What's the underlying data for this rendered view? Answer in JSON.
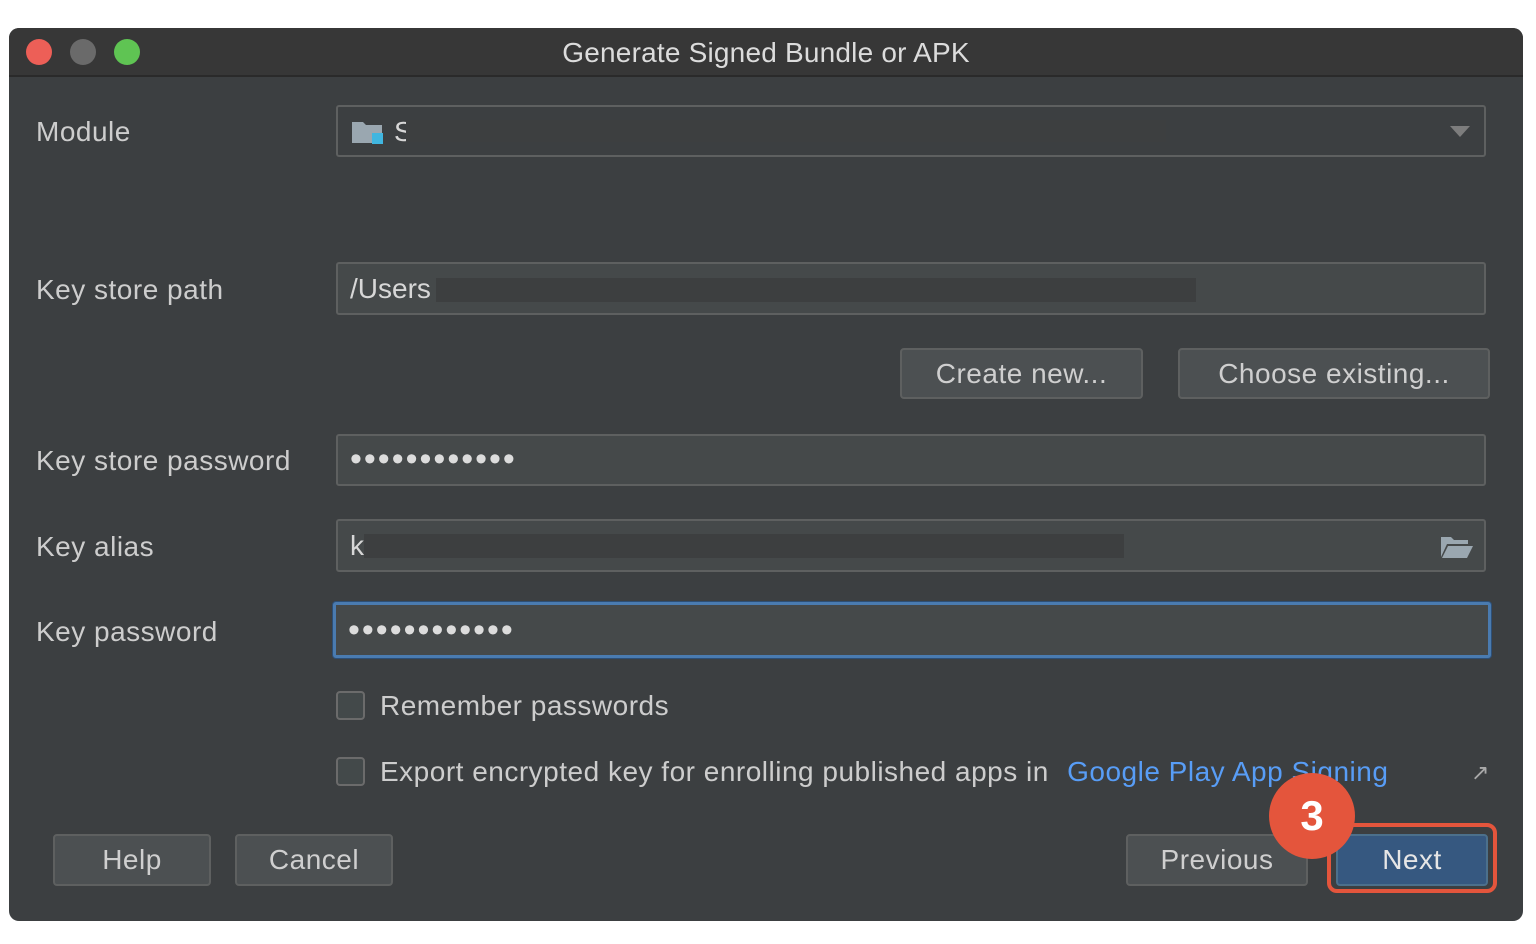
{
  "window": {
    "title": "Generate Signed Bundle or APK"
  },
  "module": {
    "label": "Module",
    "value": "S"
  },
  "key_store_path": {
    "label": "Key store path",
    "value": "/Users"
  },
  "buttons": {
    "create_new": "Create new...",
    "choose_existing": "Choose existing...",
    "help": "Help",
    "cancel": "Cancel",
    "previous": "Previous",
    "next": "Next"
  },
  "key_store_password": {
    "label": "Key store password",
    "masked_value": "••••••••••••"
  },
  "key_alias": {
    "label": "Key alias",
    "value": "k"
  },
  "key_password": {
    "label": "Key password",
    "masked_value": "••••••••••••"
  },
  "remember_passwords": {
    "label": "Remember passwords",
    "checked": false
  },
  "export_key": {
    "label": "Export encrypted key for enrolling published apps in",
    "link_text": "Google Play App Signing",
    "link_icon": "external-link-arrow-icon",
    "checked": false
  },
  "annotation": {
    "step_number": "3",
    "color": "#e4553c"
  },
  "colors": {
    "dialog_bg": "#3c3f41",
    "primary_button": "#365880",
    "link": "#589df6",
    "focus_border": "#4a7bb0"
  }
}
